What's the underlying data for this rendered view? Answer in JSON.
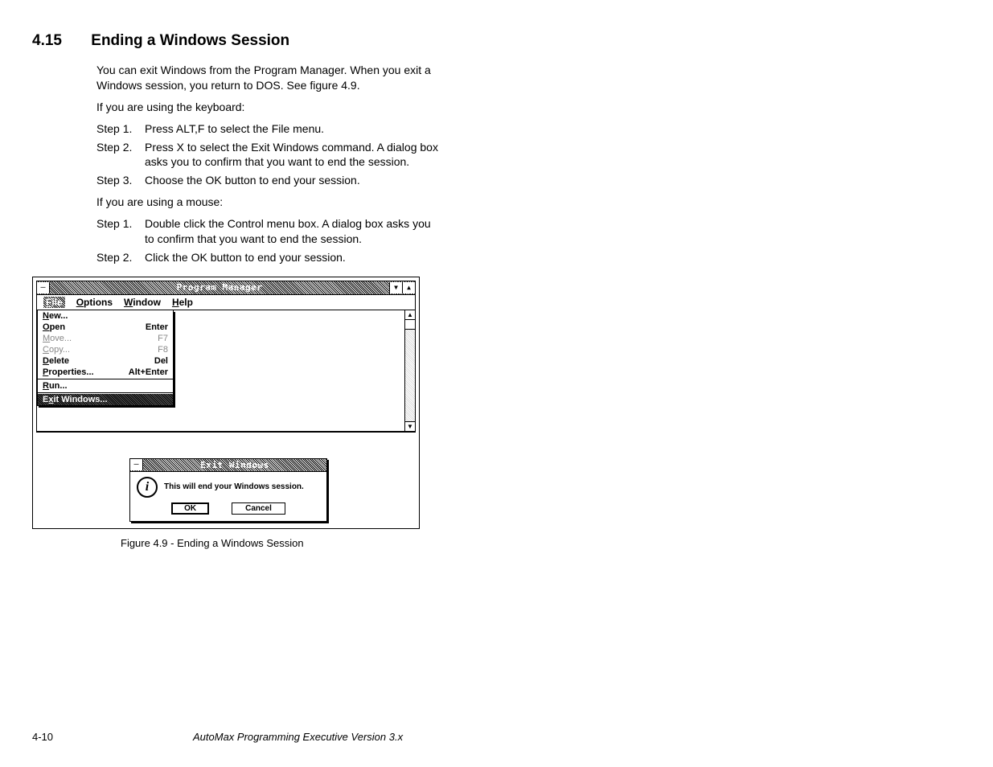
{
  "heading": {
    "number": "4.15",
    "title": "Ending a Windows Session"
  },
  "intro": "You can exit Windows from the Program Manager. When you exit a Windows session, you return to DOS. See figure 4.9.",
  "keyboard_label": "If you are using the keyboard:",
  "keyboard_steps": [
    {
      "label": "Step 1.",
      "text": "Press ALT,F to select the File menu."
    },
    {
      "label": "Step 2.",
      "text": "Press X to select the Exit Windows command. A dialog box asks you to confirm that you want to end the session."
    },
    {
      "label": "Step 3.",
      "text": "Choose the OK button to end your session."
    }
  ],
  "mouse_label": "If you are using a mouse:",
  "mouse_steps": [
    {
      "label": "Step 1.",
      "text": "Double click the Control menu box. A dialog box asks you to confirm that you want to end the session."
    },
    {
      "label": "Step 2.",
      "text": "Click the OK button to end your session."
    }
  ],
  "figure": {
    "pm_title": "Program Manager",
    "menubar": {
      "file": "File",
      "options": "Options",
      "window": "Window",
      "help": "Help"
    },
    "file_menu": {
      "new": "New...",
      "open": "Open",
      "open_accel": "Enter",
      "move": "Move...",
      "move_accel": "F7",
      "copy": "Copy...",
      "copy_accel": "F8",
      "delete": "Delete",
      "delete_accel": "Del",
      "properties": "Properties...",
      "properties_accel": "Alt+Enter",
      "run": "Run...",
      "exit": "Exit Windows..."
    },
    "dialog": {
      "title": "Exit Windows",
      "message": "This will end your Windows session.",
      "ok": "OK",
      "cancel": "Cancel"
    },
    "caption": "Figure 4.9 - Ending a Windows Session"
  },
  "footer": {
    "page": "4-10",
    "title": "AutoMax Programming Executive Version 3.x"
  }
}
